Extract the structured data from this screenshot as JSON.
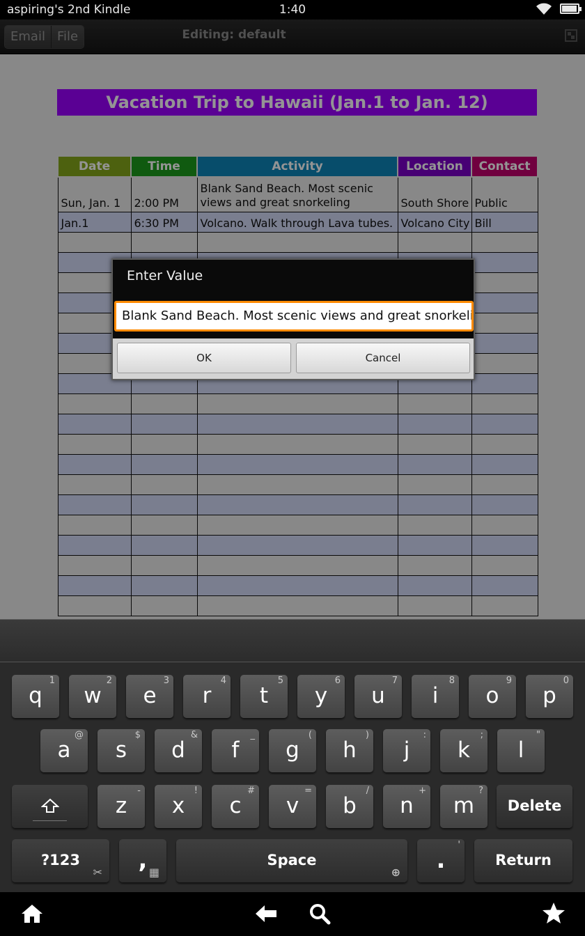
{
  "status_bar": {
    "device_name": "aspiring's 2nd Kindle",
    "time": "1:40",
    "wifi_icon": "wifi-icon",
    "battery_icon": "battery-icon"
  },
  "toolbar": {
    "email_label": "Email",
    "file_label": "File",
    "title": "Editing: default",
    "fullscreen_icon": "fullscreen-icon"
  },
  "document": {
    "title": "Vacation Trip to Hawaii (Jan.1 to Jan. 12)",
    "title_color": "#9b00ff",
    "columns": [
      {
        "label": "Date",
        "color": "#86a71a"
      },
      {
        "label": "Time",
        "color": "#1d9b1d"
      },
      {
        "label": "Activity",
        "color": "#0d86b9"
      },
      {
        "label": "Location",
        "color": "#7a00c9"
      },
      {
        "label": "Contact",
        "color": "#c2006d"
      }
    ],
    "rows": [
      [
        "Sun, Jan. 1",
        "2:00 PM",
        "Blank Sand Beach. Most scenic views and great snorkeling",
        "South Shore",
        "Public"
      ],
      [
        "Jan.1",
        "6:30 PM",
        "Volcano. Walk through Lava tubes.",
        "Volcano City",
        "Bill"
      ]
    ],
    "empty_row_count": 19
  },
  "dialog": {
    "title": "Enter Value",
    "input_value": "Blank Sand Beach. Most scenic views and great snorkeling",
    "ok_label": "OK",
    "cancel_label": "Cancel",
    "focus_color": "#ff8a00"
  },
  "keyboard": {
    "row1": [
      {
        "label": "q",
        "sec": "1"
      },
      {
        "label": "w",
        "sec": "2"
      },
      {
        "label": "e",
        "sec": "3"
      },
      {
        "label": "r",
        "sec": "4"
      },
      {
        "label": "t",
        "sec": "5"
      },
      {
        "label": "y",
        "sec": "6"
      },
      {
        "label": "u",
        "sec": "7"
      },
      {
        "label": "i",
        "sec": "8"
      },
      {
        "label": "o",
        "sec": "9"
      },
      {
        "label": "p",
        "sec": "0"
      }
    ],
    "row2": [
      {
        "label": "a",
        "sec": "@"
      },
      {
        "label": "s",
        "sec": "$"
      },
      {
        "label": "d",
        "sec": "&"
      },
      {
        "label": "f",
        "sec": "_"
      },
      {
        "label": "g",
        "sec": "("
      },
      {
        "label": "h",
        "sec": ")"
      },
      {
        "label": "j",
        "sec": ":"
      },
      {
        "label": "k",
        "sec": ";"
      },
      {
        "label": "l",
        "sec": "\""
      }
    ],
    "row3": [
      {
        "label": "z",
        "sec": "-"
      },
      {
        "label": "x",
        "sec": "!"
      },
      {
        "label": "c",
        "sec": "#"
      },
      {
        "label": "v",
        "sec": "="
      },
      {
        "label": "b",
        "sec": "/"
      },
      {
        "label": "n",
        "sec": "+"
      },
      {
        "label": "m",
        "sec": "?"
      }
    ],
    "shift_icon": "shift-icon",
    "delete_label": "Delete",
    "symbols_label": "?123",
    "comma_label": ",",
    "space_label": "Space",
    "period_label": ".",
    "period_sec": "'",
    "return_label": "Return",
    "scissors_icon": "scissors-icon",
    "keyboard_icon": "keyboard-icon",
    "globe_icon": "globe-icon"
  },
  "nav_bar": {
    "home_icon": "home-icon",
    "back_icon": "back-arrow-icon",
    "search_icon": "search-icon",
    "favorites_icon": "star-icon"
  }
}
